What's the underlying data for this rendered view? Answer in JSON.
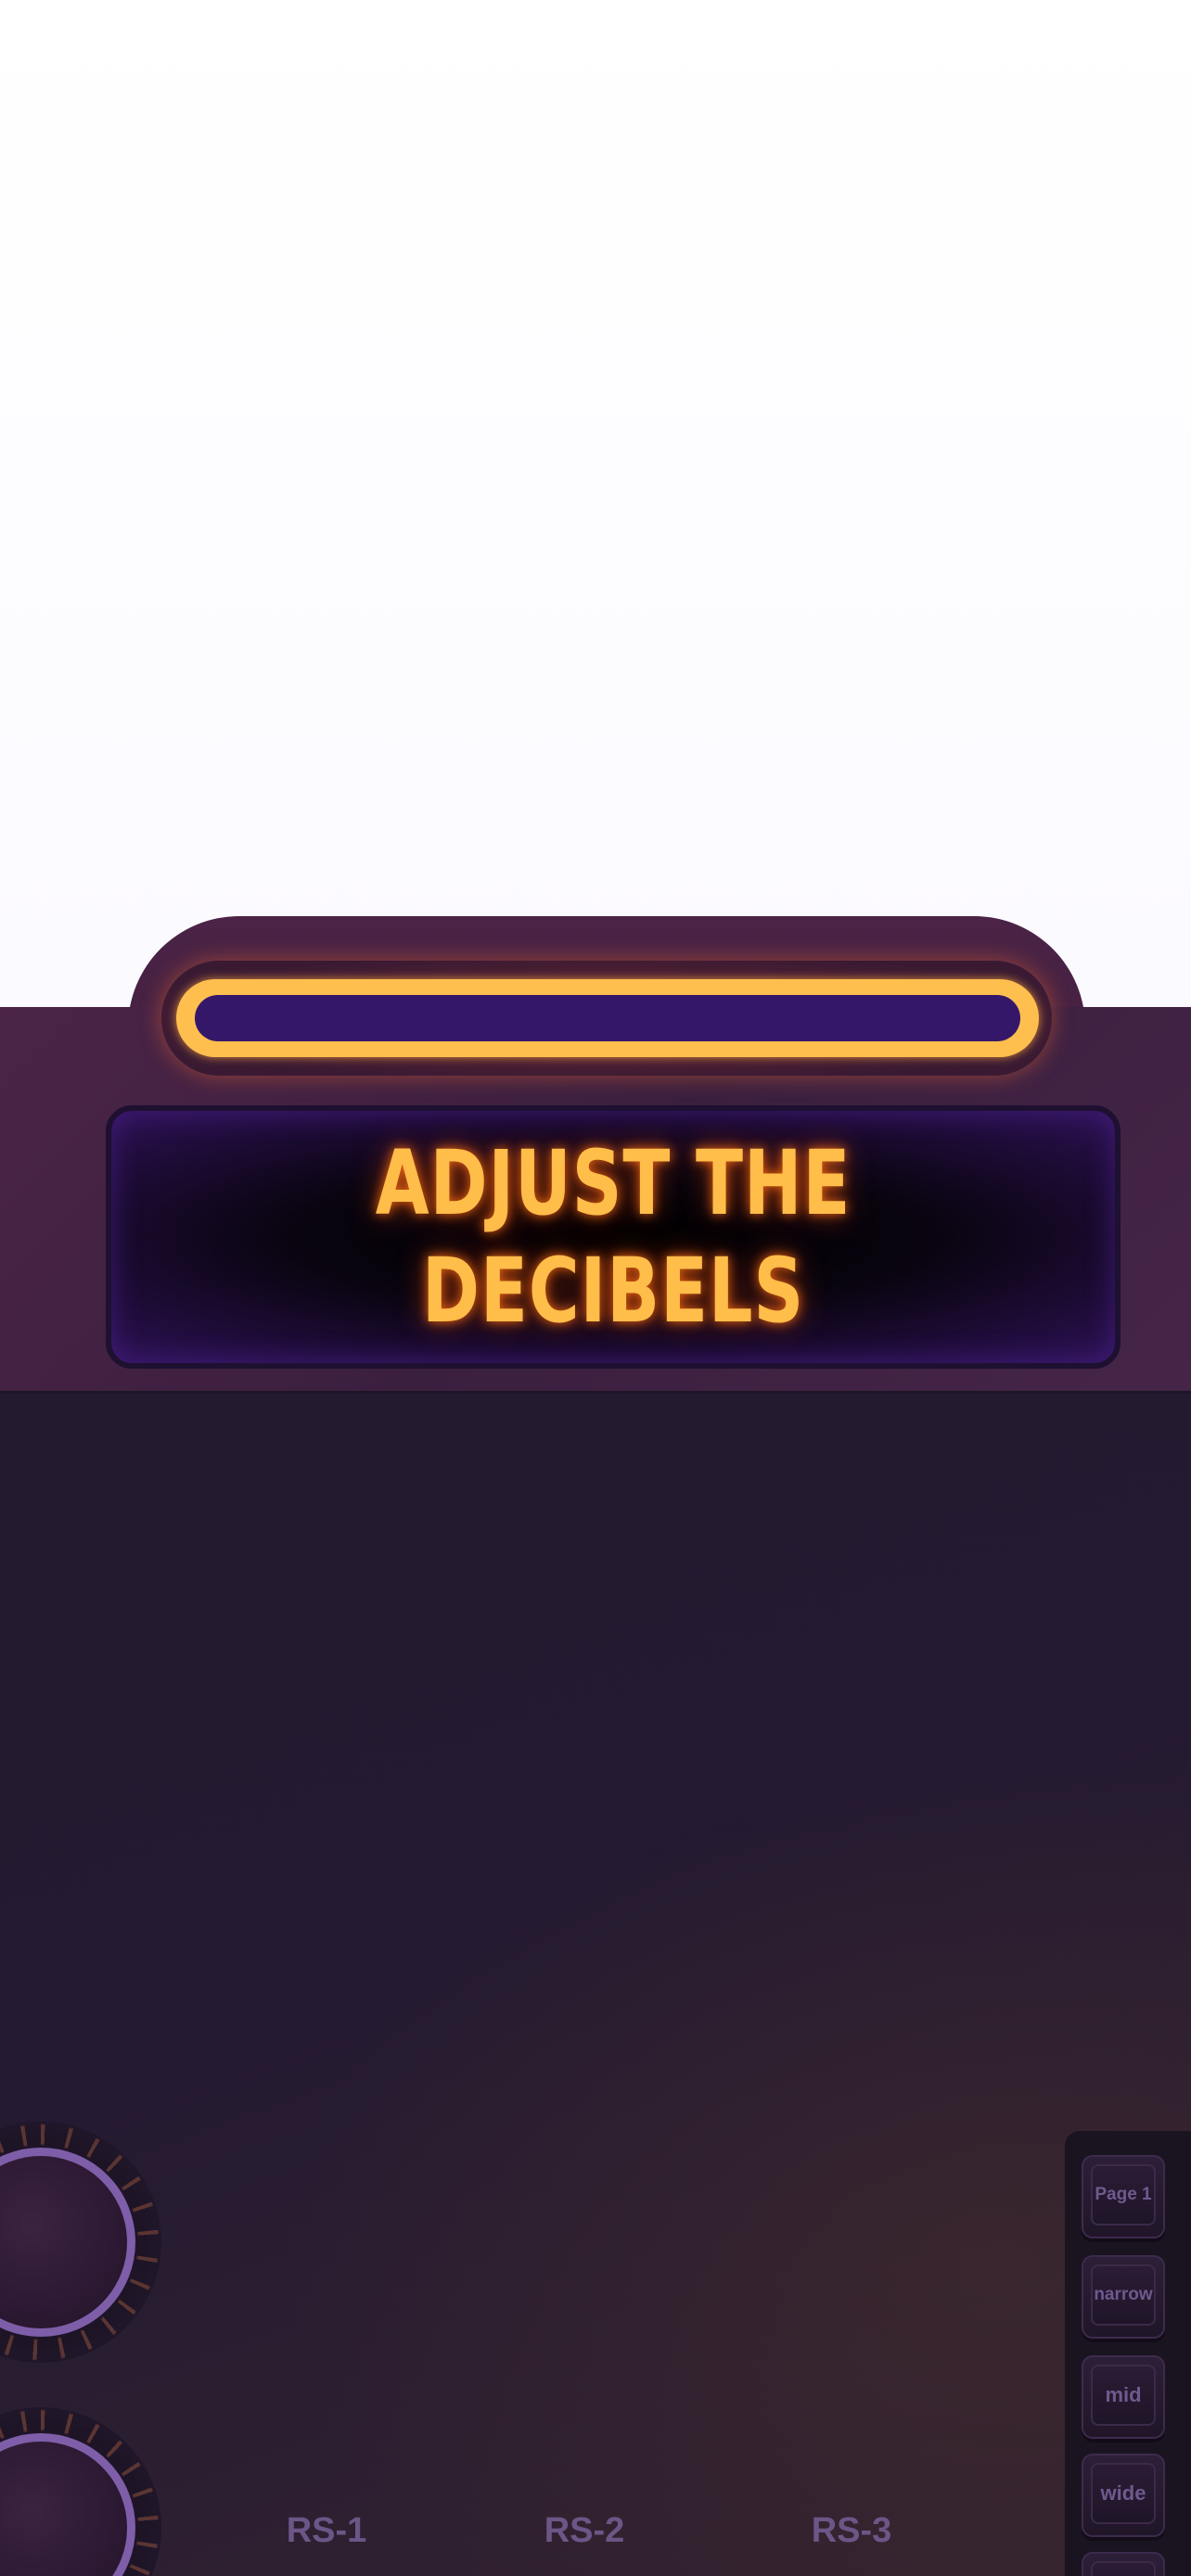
{
  "header": {
    "title": "ADJUST THE DECIBELS"
  },
  "channels": [
    "RS-1",
    "RS-2",
    "RS-3"
  ],
  "side_buttons": [
    "Page 1",
    "narrow",
    "mid",
    "wide",
    ""
  ],
  "colors": {
    "neon": "#ffbd4a",
    "screen_text_glow": "#ff6e14",
    "panel": "#241a31",
    "header": "#44213f",
    "knob_ring": "#7e5ea8",
    "label": "#6b5687"
  },
  "icons": [
    "neon-tube-light",
    "knob",
    "knob"
  ]
}
